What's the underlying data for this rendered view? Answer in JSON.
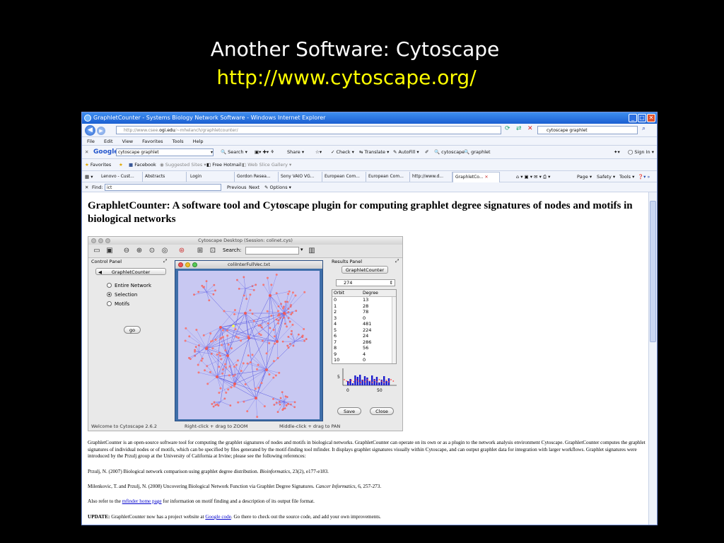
{
  "slide": {
    "title": "Another Software: Cytoscape",
    "url": "http://www.cytoscape.org/"
  },
  "browser": {
    "window_title": "GraphletCounter - Systems Biology Network Software - Windows Internet Explorer",
    "address_prefix": "http://www.csee.",
    "address_domain": "ogi.edu",
    "address_suffix": "/~mhelanch/graphletcounter/",
    "search_value": "cytoscape graphlet",
    "menu": [
      "File",
      "Edit",
      "View",
      "Favorites",
      "Tools",
      "Help"
    ],
    "google": {
      "label": "Google",
      "query": "cytoscape graphlet",
      "search_label": "Search",
      "share_label": "Share",
      "check_label": "Check",
      "translate_label": "Translate",
      "autofill_label": "AutoFill",
      "term1": "cytoscape",
      "term2": "graphlet",
      "signin_label": "Sign In"
    },
    "favorites": {
      "label": "Favorites",
      "items": [
        "Facebook",
        "Suggested Sites",
        "Free Hotmail",
        "Web Slice Gallery"
      ]
    },
    "tabs": [
      "Lenovo - Cust...",
      "Abstracts",
      "Login",
      "Gordon Resea...",
      "Sony VAIO VG...",
      "European Com...",
      "European Com...",
      "http://www.d...",
      "GraphletCo..."
    ],
    "command_bar": {
      "page": "Page",
      "safety": "Safety",
      "tools": "Tools"
    },
    "find": {
      "label": "Find:",
      "value": "ict",
      "previous": "Previous",
      "next": "Next",
      "options": "Options"
    }
  },
  "page": {
    "heading": "GraphletCounter: A software tool and Cytoscape plugin for computing graphlet degree signatures of nodes and motifs in biological networks",
    "p1": "GraphletCounter is an open-source software tool for computing the graphlet signatures of nodes and motifs in biological networks. GraphletCounter can operate on its own or as a plugin to the network analysis environment Cytoscape. GraphletCounter computes the graphlet signatures of individual nodes or of motifs, which can be specified by files generated by the motif-finding tool mfinder. It displays graphlet signatures visually within Cytoscape, and can output graphlet data for integration with larger workflows. Graphlet signatures were introduced by the Przulj group at the University of California at Irvine; please see the following references:",
    "ref1_a": "Przulj, N. (2007) Biological network comparison using graphlet degree distribution. ",
    "ref1_journal": "Bioinformatics",
    "ref1_b": ", 23(2), e177-e183.",
    "ref2_a": "Milenkovic, T. and Przulj, N. (2008) Uncovering Biological Network Function via Graphlet Degree Signatures. ",
    "ref2_journal": "Cancer Informatics",
    "ref2_b": ", 6, 257-273.",
    "also_a": "Also refer to the ",
    "also_link": "mfinder home page",
    "also_b": " for information on motif finding and a description of its output file format.",
    "update_label": "UPDATE:",
    "update_a": " GraphletCounter now has a project website at ",
    "update_link": "Google code",
    "update_b": ". Go there to check out the source code, and add your own improvements."
  },
  "cytoscape": {
    "window_title": "Cytoscape Desktop (Session: colinet.cys)",
    "search_label": "Search:",
    "control_panel_title": "Control Panel",
    "control_tab": "GraphletCounter",
    "radio": [
      "Entire Network",
      "Selection",
      "Motifs"
    ],
    "selected_radio": "Selection",
    "go_label": "go",
    "network_window_title": "coliInterFullVec.txt",
    "results_panel_title": "Results Panel",
    "results_tab": "GraphletCounter",
    "selected_node": "274",
    "table_headers": [
      "Orbit",
      "Degree"
    ],
    "orbits": [
      [
        "0",
        "13"
      ],
      [
        "1",
        "28"
      ],
      [
        "2",
        "78"
      ],
      [
        "3",
        "0"
      ],
      [
        "4",
        "481"
      ],
      [
        "5",
        "224"
      ],
      [
        "6",
        "24"
      ],
      [
        "7",
        "286"
      ],
      [
        "8",
        "56"
      ],
      [
        "9",
        "4"
      ],
      [
        "10",
        "0"
      ]
    ],
    "hist_y_tick": "5",
    "hist_x_ticks": [
      "0",
      "50"
    ],
    "save_label": "Save",
    "close_label": "Close",
    "status_welcome": "Welcome to Cytoscape 2.6.2",
    "status_zoom": "Right-click + drag  to  ZOOM",
    "status_pan": "Middle-click + drag  to  PAN"
  }
}
